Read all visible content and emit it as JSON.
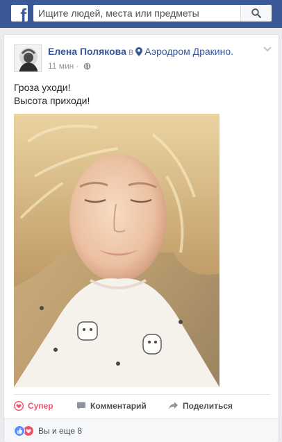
{
  "topbar": {
    "logo_glyph": "f",
    "search_placeholder": "Ищите людей, места или предметы"
  },
  "post": {
    "author_name": "Елена Полякова",
    "in_word": "в",
    "place": "Аэродром Дракино.",
    "time": "11 мин",
    "separator": "·",
    "text_lines": [
      "Гроза уходи!",
      "Высота приходи!"
    ]
  },
  "actions": {
    "like": "Супер",
    "comment": "Комментарий",
    "share": "Поделиться"
  },
  "reactions": {
    "summary": "Вы и еще 8"
  },
  "colors": {
    "brand": "#3b5998",
    "link": "#365899",
    "love": "#f25268",
    "like": "#5890ff"
  }
}
